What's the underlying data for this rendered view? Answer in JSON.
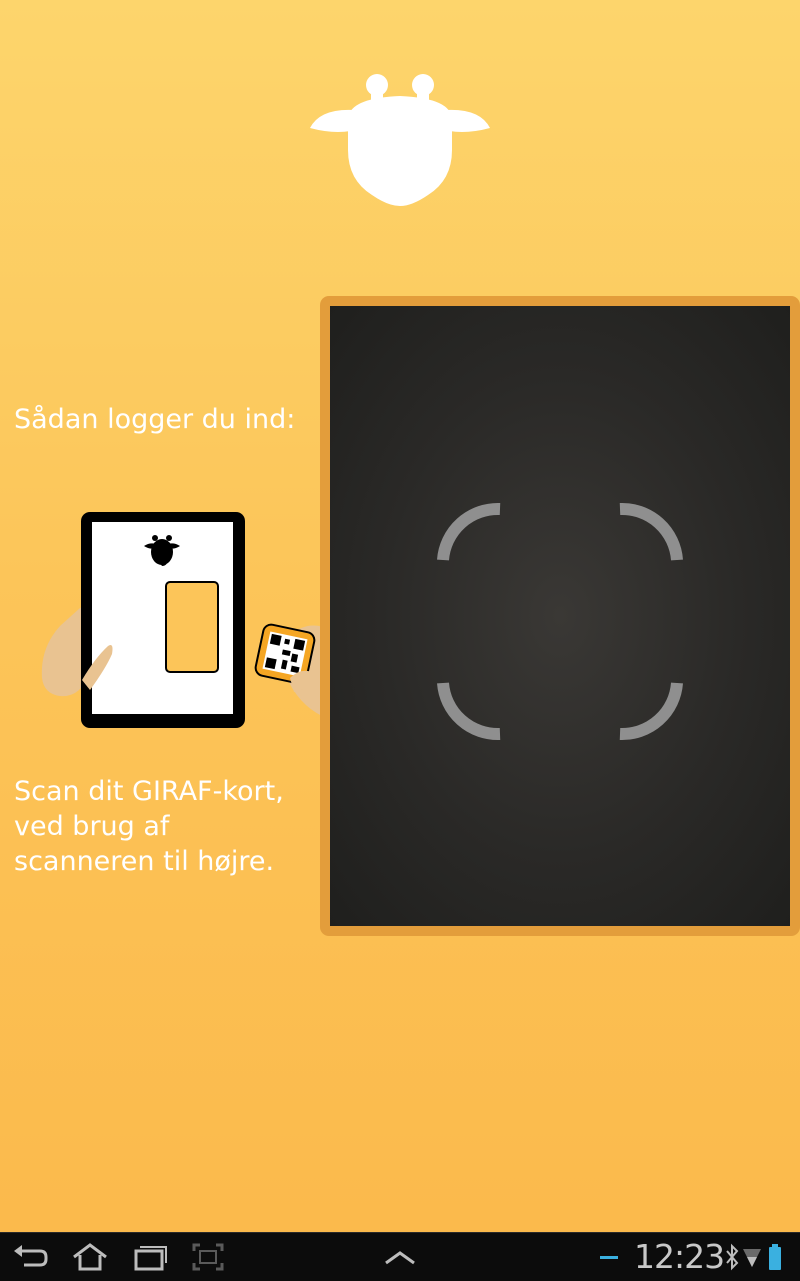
{
  "app": {
    "logo": "giraf-giraffe-icon"
  },
  "login": {
    "title": "Sådan logger du ind:",
    "instruction": "Scan dit GIRAF-kort,\nved brug af\nscanneren til højre."
  },
  "scanner": {
    "viewfinder": "viewfinder-corners"
  },
  "colors": {
    "background_top": "#fdd56c",
    "background_bottom": "#fbb94b",
    "frame": "#e39d3b",
    "scanner": "#2a2927"
  },
  "system_bar": {
    "buttons": [
      "back-icon",
      "home-icon",
      "recent-apps-icon",
      "screenshot-icon",
      "menu-up-icon"
    ],
    "clock": "12:23",
    "status_icons": [
      "minus-icon",
      "bluetooth-icon",
      "wifi-icon",
      "battery-icon"
    ]
  }
}
